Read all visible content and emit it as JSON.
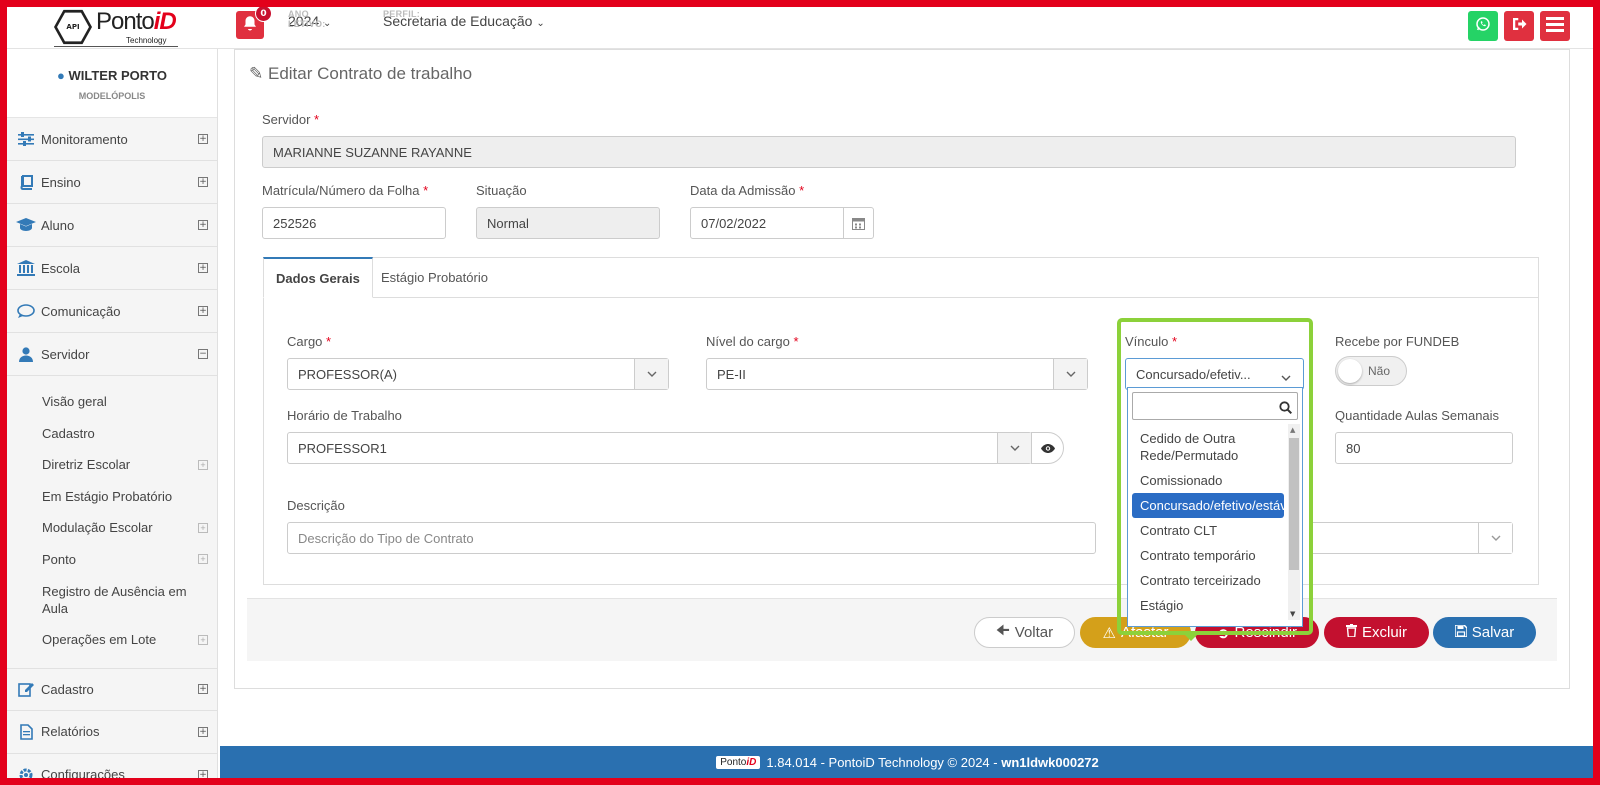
{
  "brand": {
    "api": "API",
    "name_a": "Ponto",
    "name_b": "iD",
    "tech": "Technology"
  },
  "topbar": {
    "notifications": "0",
    "ano_label": "ANO LETIVO:",
    "ano_value": "2024",
    "perfil_label": "PERFIL:",
    "perfil_value": "Secretaria de Educação",
    "colors": {
      "whatsapp": "#25d366",
      "logout": "#e0303f",
      "menu": "#e0303f"
    }
  },
  "user": {
    "name": "WILTER PORTO",
    "city": "MODELÓPOLIS"
  },
  "sidebar": {
    "items": [
      {
        "label": "Monitoramento",
        "icon": "sliders-icon"
      },
      {
        "label": "Ensino",
        "icon": "book-icon"
      },
      {
        "label": "Aluno",
        "icon": "graduation-cap-icon"
      },
      {
        "label": "Escola",
        "icon": "institution-icon"
      },
      {
        "label": "Comunicação",
        "icon": "chat-bubble-icon"
      },
      {
        "label": "Servidor",
        "icon": "user-icon"
      }
    ],
    "servidor_sub": [
      {
        "label": "Visão geral"
      },
      {
        "label": "Cadastro"
      },
      {
        "label": "Diretriz Escolar"
      },
      {
        "label": "Em Estágio Probatório"
      },
      {
        "label": "Modulação Escolar"
      },
      {
        "label": "Ponto"
      },
      {
        "label": "Registro de Ausência em Aula"
      },
      {
        "label": "Operações em Lote"
      }
    ],
    "bottom_items": [
      {
        "label": "Cadastro",
        "icon": "edit-icon"
      },
      {
        "label": "Relatórios",
        "icon": "file-text-icon"
      },
      {
        "label": "Configurações",
        "icon": "gear-icon"
      }
    ]
  },
  "form": {
    "title": "Editar Contrato de trabalho",
    "servidor_label": "Servidor",
    "servidor_value": "MARIANNE SUZANNE RAYANNE",
    "matricula_label": "Matrícula/Número da Folha",
    "matricula_value": "252526",
    "situacao_label": "Situação",
    "situacao_value": "Normal",
    "admissao_label": "Data da Admissão",
    "admissao_value": "07/02/2022",
    "tabs": [
      "Dados Gerais",
      "Estágio Probatório"
    ],
    "cargo_label": "Cargo",
    "cargo_value": "PROFESSOR(A)",
    "nivel_label": "Nível do cargo",
    "nivel_value": "PE-II",
    "vinculo_label": "Vínculo",
    "vinculo_value": "Concursado/efetiv...",
    "fundeb_label": "Recebe por FUNDEB",
    "fundeb_value": "Não",
    "horario_label": "Horário de Trabalho",
    "horario_value": "PROFESSOR1",
    "aulas_label": "Quantidade Aulas Semanais",
    "aulas_value": "80",
    "descricao_label": "Descrição",
    "descricao_placeholder": "Descrição do Tipo de Contrato"
  },
  "dropdown": {
    "options": [
      "Cedido de Outra Rede/Permutado",
      "Comissionado",
      "Concursado/efetivo/estável",
      "Contrato CLT",
      "Contrato temporário",
      "Contrato terceirizado",
      "Estágio"
    ],
    "selected_index": 2
  },
  "actions": {
    "voltar": "Voltar",
    "afastar": "Afastar",
    "rescindir": "Rescindir",
    "excluir": "Excluir",
    "salvar": "Salvar",
    "colors": {
      "afastar": "#d4a01a",
      "rescindir": "#c3102f",
      "excluir": "#c3102f",
      "salvar": "#2a70b0"
    }
  },
  "footer": {
    "logo_a": "Ponto",
    "logo_b": "iD",
    "version": "1.84.014 - PontoiD Technology © 2024 - ",
    "host": "wn1ldwk000272"
  }
}
